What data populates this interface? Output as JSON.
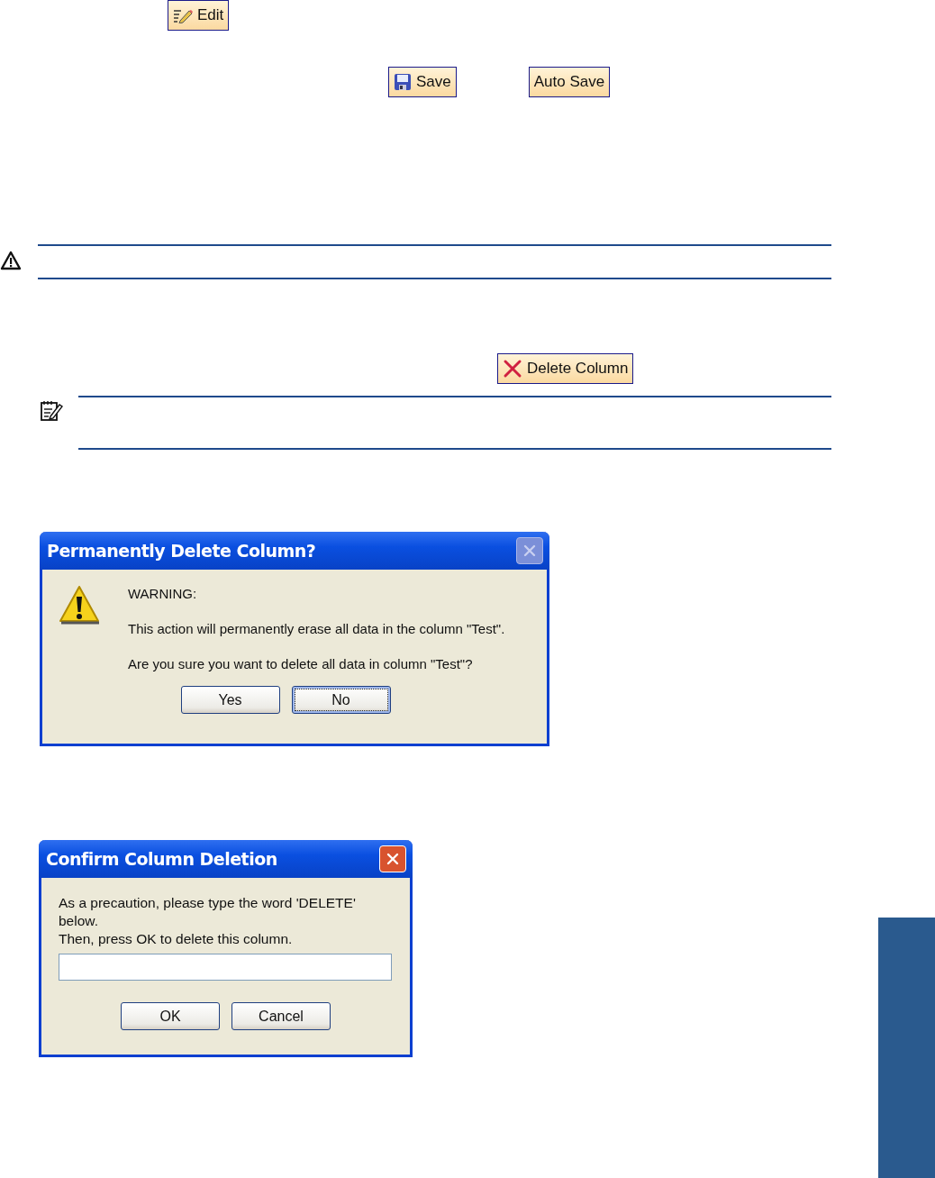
{
  "edit_button": {
    "label": "Edit",
    "kind": "pencil"
  },
  "save_buttons": [
    {
      "label": "Save",
      "kind": "disk"
    },
    {
      "label": "Auto Save",
      "kind": "text"
    }
  ],
  "delete_button": {
    "label": "Delete Column",
    "kind": "cross"
  },
  "dialogs": [
    {
      "title": "Permanently Delete Column?",
      "close_disabled": true,
      "kind": "message",
      "lines": [
        "WARNING:",
        "This action will permanently erase all data in the column \"Test\".",
        "Are you sure you want to delete all data in column \"Test\"?"
      ],
      "buttons": [
        {
          "label": "Yes",
          "focused": false
        },
        {
          "label": "No",
          "focused": true
        }
      ]
    },
    {
      "title": "Confirm Column Deletion",
      "close_disabled": false,
      "kind": "input",
      "lines": [
        "As a precaution, please type the word 'DELETE' below.",
        "Then, press OK to delete this column."
      ],
      "buttons": [
        {
          "label": "OK",
          "focused": false
        },
        {
          "label": "Cancel",
          "focused": false
        }
      ]
    }
  ]
}
